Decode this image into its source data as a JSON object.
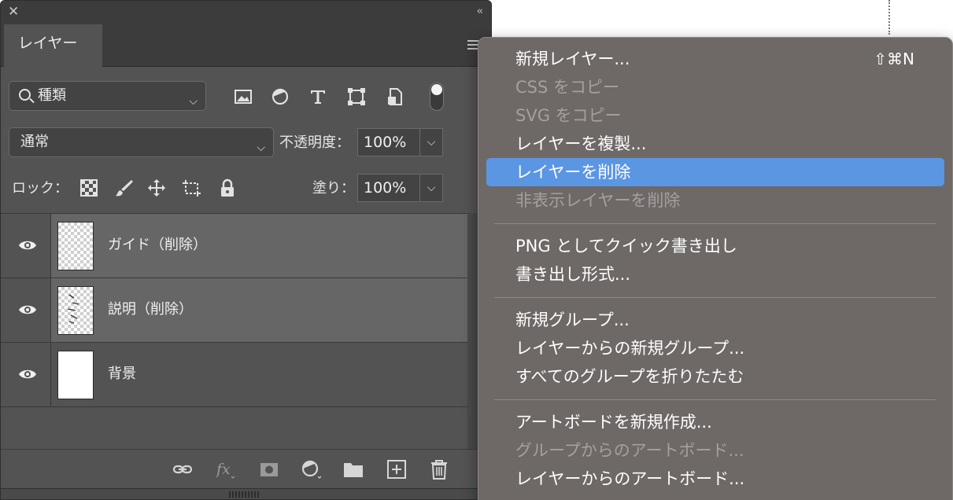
{
  "panel": {
    "tab_label": "レイヤー",
    "filter": {
      "kind_label": "種類",
      "icons": [
        "image-filter-icon",
        "adjustment-filter-icon",
        "type-filter-icon",
        "shape-filter-icon",
        "smart-object-filter-icon",
        "filter-toggle"
      ]
    },
    "blend": {
      "mode": "通常",
      "opacity_label": "不透明度：",
      "opacity_value": "100%"
    },
    "lock": {
      "label": "ロック：",
      "fill_label": "塗り：",
      "fill_value": "100%"
    },
    "layers": [
      {
        "name": "ガイド（削除）",
        "selected": true,
        "thumb": "transparent"
      },
      {
        "name": "説明（削除）",
        "selected": true,
        "thumb": "transparent"
      },
      {
        "name": "背景",
        "selected": false,
        "thumb": "white"
      }
    ],
    "bottom_icons": [
      "link-icon",
      "fx-icon",
      "mask-icon",
      "adjustment-icon",
      "folder-icon",
      "new-layer-icon",
      "trash-icon"
    ]
  },
  "menu": {
    "groups": [
      [
        {
          "label": "新規レイヤー...",
          "shortcut": "⇧⌘N",
          "enabled": true
        },
        {
          "label": "CSS をコピー",
          "enabled": false
        },
        {
          "label": "SVG をコピー",
          "enabled": false
        },
        {
          "label": "レイヤーを複製...",
          "enabled": true
        },
        {
          "label": "レイヤーを削除",
          "enabled": true,
          "highlighted": true
        },
        {
          "label": "非表示レイヤーを削除",
          "enabled": false
        }
      ],
      [
        {
          "label": "PNG としてクイック書き出し",
          "enabled": true
        },
        {
          "label": "書き出し形式...",
          "enabled": true
        }
      ],
      [
        {
          "label": "新規グループ...",
          "enabled": true
        },
        {
          "label": "レイヤーからの新規グループ...",
          "enabled": true
        },
        {
          "label": "すべてのグループを折りたたむ",
          "enabled": true
        }
      ],
      [
        {
          "label": "アートボードを新規作成...",
          "enabled": true
        },
        {
          "label": "グループからのアートボード...",
          "enabled": false
        },
        {
          "label": "レイヤーからのアートボード...",
          "enabled": true
        }
      ]
    ],
    "highlight_color": "#5b96e3"
  }
}
